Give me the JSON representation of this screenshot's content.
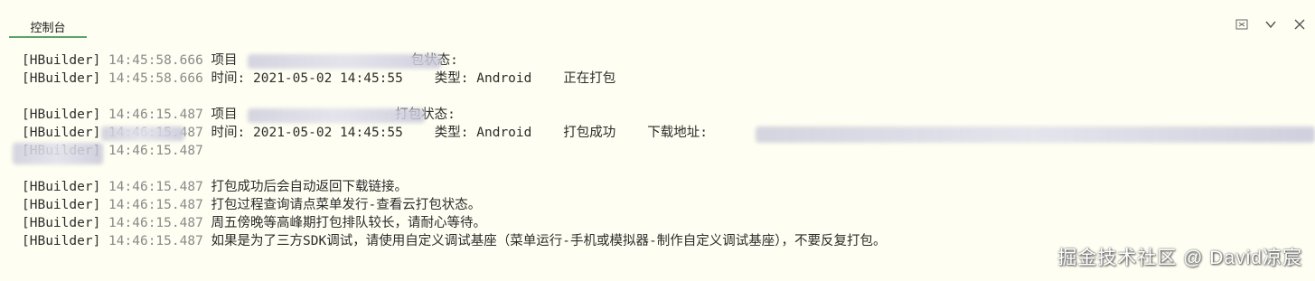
{
  "tab": {
    "label": "控制台"
  },
  "toolbar": {
    "icons": [
      "clear-console-icon",
      "chevron-down-icon",
      "close-icon"
    ]
  },
  "lines": [
    {
      "prefix": "[HBuilder]",
      "time": "14:45:58.666",
      "msg": "项目                      包状态:"
    },
    {
      "prefix": "[HBuilder]",
      "time": "14:45:58.666",
      "msg": "时间: 2021-05-02 14:45:55    类型: Android    正在打包"
    },
    {
      "prefix": "",
      "time": "",
      "msg": ""
    },
    {
      "prefix": "[HBuilder]",
      "time": "14:46:15.487",
      "msg": "项目                    打包状态:"
    },
    {
      "prefix": "[HBuilder]",
      "time": "14:46:15.487",
      "msg": "时间: 2021-05-02 14:45:55    类型: Android    打包成功    下载地址:"
    },
    {
      "prefix": "[HBuilder]",
      "time": "14:46:15.487",
      "msg": ""
    },
    {
      "prefix": "",
      "time": "",
      "msg": ""
    },
    {
      "prefix": "[HBuilder]",
      "time": "14:46:15.487",
      "msg": "打包成功后会自动返回下载链接。"
    },
    {
      "prefix": "[HBuilder]",
      "time": "14:46:15.487",
      "msg": "打包过程查询请点菜单发行-查看云打包状态。"
    },
    {
      "prefix": "[HBuilder]",
      "time": "14:46:15.487",
      "msg": "周五傍晚等高峰期打包排队较长，请耐心等待。"
    },
    {
      "prefix": "[HBuilder]",
      "time": "14:46:15.487",
      "msg": "如果是为了三方SDK调试，请使用自定义调试基座（菜单运行-手机或模拟器-制作自定义调试基座），不要反复打包。"
    }
  ],
  "watermark": "掘金技术社区 @ David凉宸"
}
